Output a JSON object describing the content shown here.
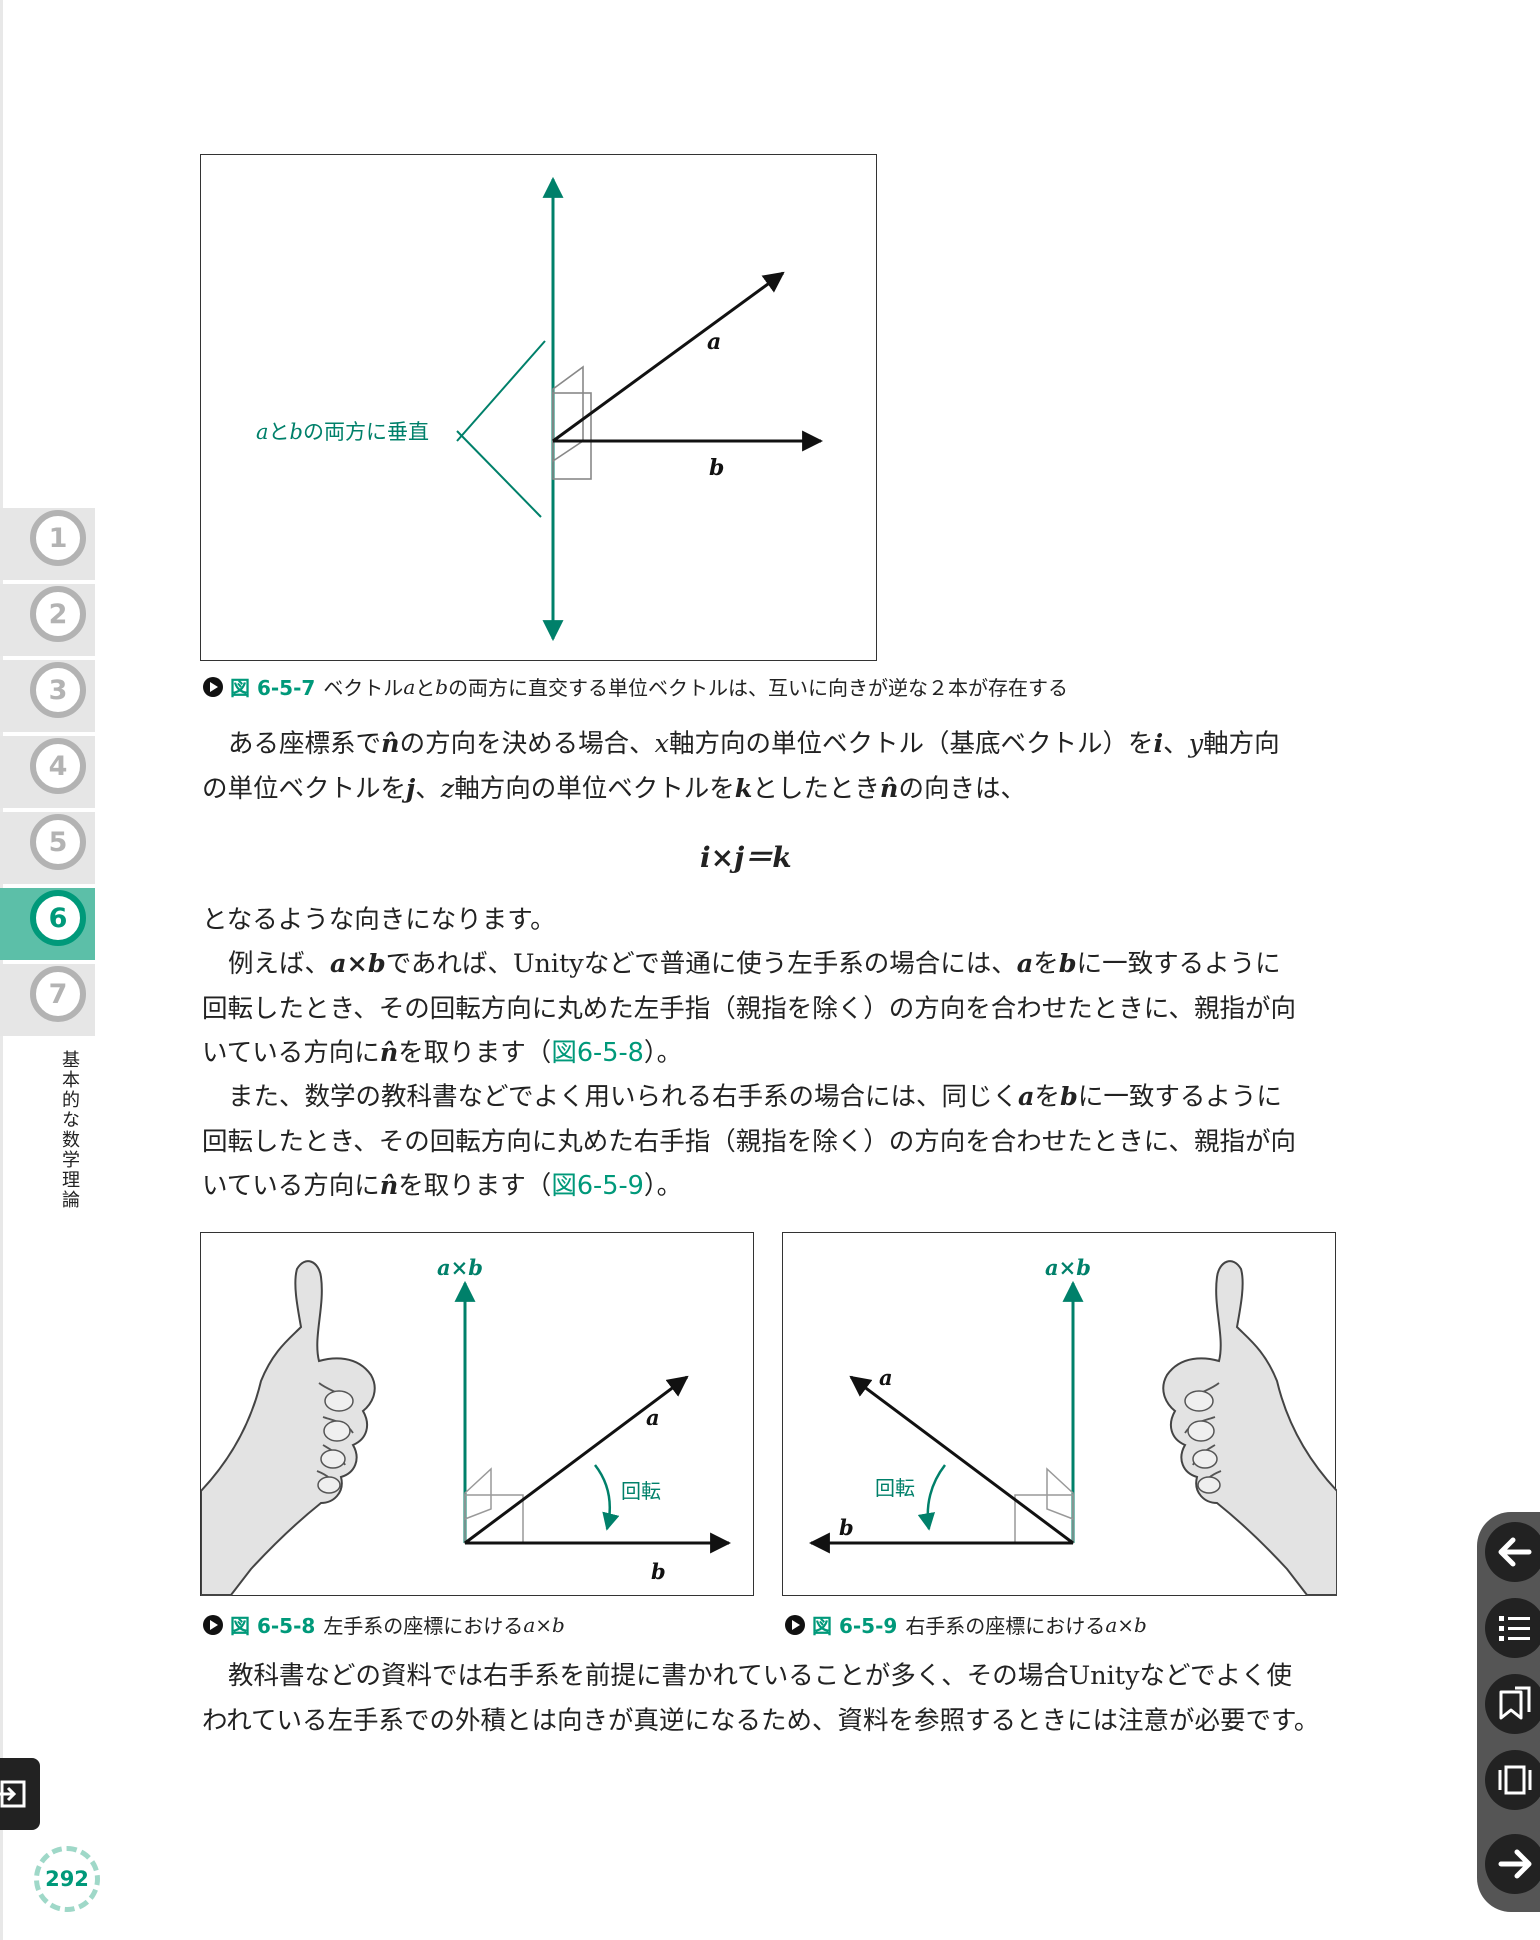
{
  "chapters": [
    "1",
    "2",
    "3",
    "4",
    "5",
    "6",
    "7"
  ],
  "active_chapter": "6",
  "chapter_title": "基本的な数学理論",
  "page_number": "292",
  "fig1": {
    "label_a": "a",
    "label_b": "b",
    "perp_a": "a",
    "perp_to": "と",
    "perp_b": "b",
    "perp_rest": "の両方に垂直",
    "caption_num": "図 6-5-7",
    "caption_pre": "ベクトル",
    "caption_a": "a",
    "caption_to": "と",
    "caption_b": "b",
    "caption_rest": "の両方に直交する単位ベクトルは、互いに向きが逆な２本が存在する"
  },
  "para1": {
    "l1_a": "ある座標系で",
    "nhat": "n̂",
    "l1_b": "の方向を決める場合、",
    "x": "x",
    "l1_c": "軸方向の単位ベクトル（基底ベクトル）を",
    "i": "i",
    "l1_d": "、",
    "y": "y",
    "l1_e": "軸方向",
    "l2_a": "の単位ベクトルを",
    "j": "j",
    "l2_b": "、",
    "z": "z",
    "l2_c": "軸方向の単位ベクトルを",
    "k": "k",
    "l2_d": "としたとき",
    "l2_e": "の向きは、"
  },
  "equation": "i×j＝k",
  "para2": "となるような向きになります。",
  "para3": {
    "l1_a": "例えば、",
    "axb": "a×b",
    "l1_b": "であれば、Unityなどで普通に使う左手系の場合には、",
    "a": "a",
    "l1_c": "を",
    "b": "b",
    "l1_d": "に一致するように",
    "l2": "回転したとき、その回転方向に丸めた左手指（親指を除く）の方向を合わせたときに、親指が向",
    "l3_a": "いている方向に",
    "nhat": "n̂",
    "l3_b": "を取ります（",
    "ref": "図6-5-8",
    "l3_c": "）。"
  },
  "para4": {
    "l1_a": "また、数学の教科書などでよく用いられる右手系の場合には、同じく",
    "a": "a",
    "l1_b": "を",
    "b": "b",
    "l1_c": "に一致するように",
    "l2": "回転したとき、その回転方向に丸めた右手指（親指を除く）の方向を合わせたときに、親指が向",
    "l3_a": "いている方向に",
    "nhat": "n̂",
    "l3_b": "を取ります（",
    "ref": "図6-5-9",
    "l3_c": "）。"
  },
  "fig2": {
    "axb": "a×b",
    "a": "a",
    "b": "b",
    "rotation": "回転",
    "caption_num": "図 6-5-8",
    "caption_text": "左手系の座標における",
    "caption_axb": "a×b"
  },
  "fig3": {
    "axb": "a×b",
    "a": "a",
    "b": "b",
    "rotation": "回転",
    "caption_num": "図 6-5-9",
    "caption_text": "右手系の座標における",
    "caption_axb": "a×b"
  },
  "para5": {
    "l1": "教科書などの資料では右手系を前提に書かれていることが多く、その場合Unityなどでよく使",
    "l2": "われている左手系での外積とは向きが真逆になるため、資料を参照するときには注意が必要です。"
  },
  "colors": {
    "accent": "#00997a",
    "tab_gray": "#b3b3b3",
    "tab_active_bg": "#5cbfa8"
  },
  "nav_icons": [
    "arrow-left-icon",
    "list-icon",
    "bookmark-icon",
    "pages-icon",
    "arrow-right-icon"
  ]
}
